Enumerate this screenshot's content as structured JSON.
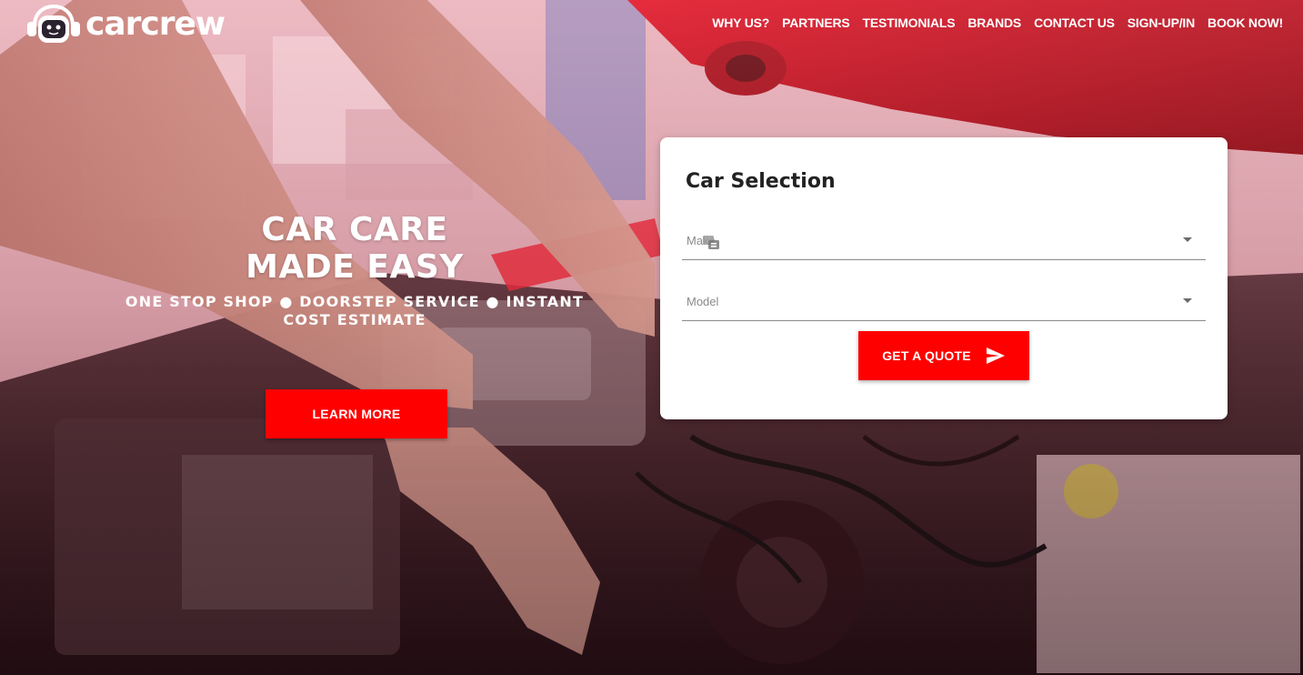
{
  "brand": {
    "name": "carcrew"
  },
  "nav": {
    "items": [
      {
        "label": "WHY US?"
      },
      {
        "label": "PARTNERS"
      },
      {
        "label": "TESTIMONIALS"
      },
      {
        "label": "BRANDS"
      },
      {
        "label": "CONTACT US"
      },
      {
        "label": "SIGN-UP/IN"
      },
      {
        "label": "BOOK NOW!"
      }
    ]
  },
  "hero": {
    "title_line1": "CAR CARE",
    "title_line2": "MADE EASY",
    "subtitle": "ONE STOP SHOP ● DOORSTEP SERVICE ● INSTANT COST ESTIMATE",
    "cta_label": "LEARN MORE"
  },
  "car_selection": {
    "title": "Car Selection",
    "make_label": "Make",
    "model_label": "Model",
    "quote_label": "GET A QUOTE"
  },
  "colors": {
    "accent": "#ff0000",
    "card_background": "#ffffff",
    "text_white": "#ffffff"
  },
  "icons": {
    "logo": "mechanic-face-headphones-icon",
    "quote": "send-arrow-icon",
    "dropdown": "caret-down-icon"
  }
}
